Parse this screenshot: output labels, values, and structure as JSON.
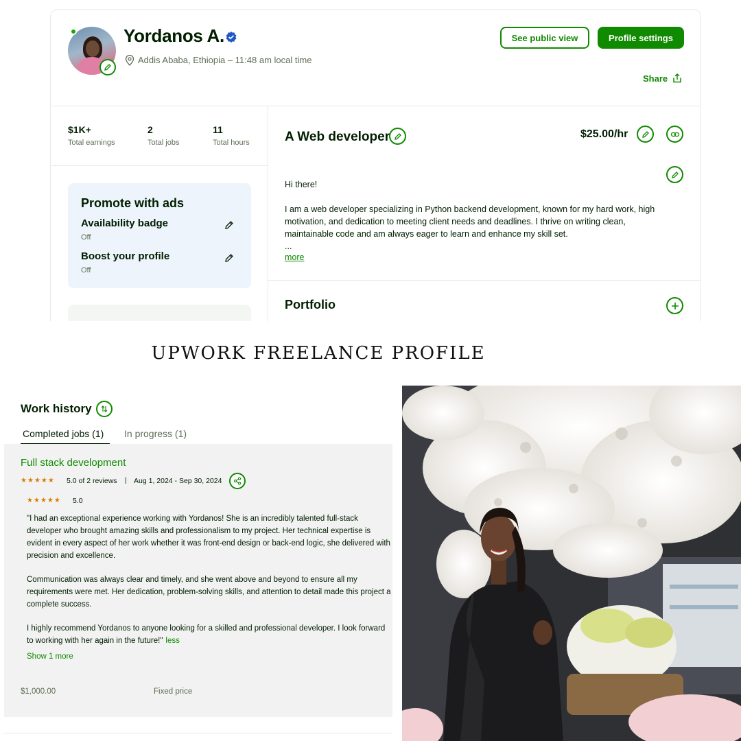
{
  "profile": {
    "name": "Yordanos A.",
    "location": "Addis Ababa, Ethiopia – 11:48 am local time",
    "see_public_view": "See public view",
    "profile_settings": "Profile settings",
    "share": "Share",
    "online": true,
    "icons": {
      "verified": "verified-badge-icon",
      "location": "location-pin-icon",
      "edit": "pencil-icon",
      "share": "share-upload-icon",
      "link": "link-icon",
      "add": "plus-icon"
    }
  },
  "stats": [
    {
      "value": "$1K+",
      "label": "Total earnings"
    },
    {
      "value": "2",
      "label": "Total jobs"
    },
    {
      "value": "11",
      "label": "Total hours"
    }
  ],
  "promote": {
    "title": "Promote with ads",
    "items": [
      {
        "title": "Availability badge",
        "status": "Off"
      },
      {
        "title": "Boost your profile",
        "status": "Off"
      }
    ]
  },
  "headline": {
    "title": "A Web developer",
    "rate": "$25.00/hr"
  },
  "overview": {
    "greeting": "Hi there!",
    "body": "I am a web developer specializing in Python backend development, known for my hard work, high motivation, and dedication to meeting client needs and deadlines. I thrive on writing clean, maintainable code and am always eager to learn and enhance my skill set.",
    "ellipsis": "...",
    "more": "more"
  },
  "portfolio": {
    "title": "Portfolio"
  },
  "caption": "UPWORK FREELANCE PROFILE",
  "work_history": {
    "title": "Work history",
    "tabs": [
      {
        "label": "Completed jobs (1)",
        "active": true
      },
      {
        "label": "In progress (1)",
        "active": false
      }
    ],
    "job": {
      "title": "Full stack development",
      "rating_summary": "5.0 of 2 reviews",
      "separator": "|",
      "dates": "Aug 1, 2024 - Sep 30, 2024",
      "review_rating": "5.0",
      "stars": 5,
      "review_paragraphs": [
        "\"I had an exceptional experience working with Yordanos! She is an incredibly talented full-stack developer who brought amazing skills and professionalism to my project. Her technical expertise is evident in every aspect of her work whether it was front-end design or back-end logic, she delivered with precision and excellence.",
        "Communication was always clear and timely, and she went above and beyond to ensure all my requirements were met. Her dedication, problem-solving skills, and attention to detail made this project a complete success.",
        "I highly recommend Yordanos to anyone looking for a skilled and professional developer. I look forward to working with her again in the future!\""
      ],
      "less": "less",
      "show_more": "Show 1 more",
      "price": "$1,000.00",
      "price_type": "Fixed price"
    }
  },
  "colors": {
    "brand_green": "#108a00",
    "text_dark": "#001e00",
    "text_muted": "#5e6d55",
    "star_orange": "#d77b00",
    "promo_bg": "#eef4fc",
    "verified_blue": "#1f57c3"
  }
}
